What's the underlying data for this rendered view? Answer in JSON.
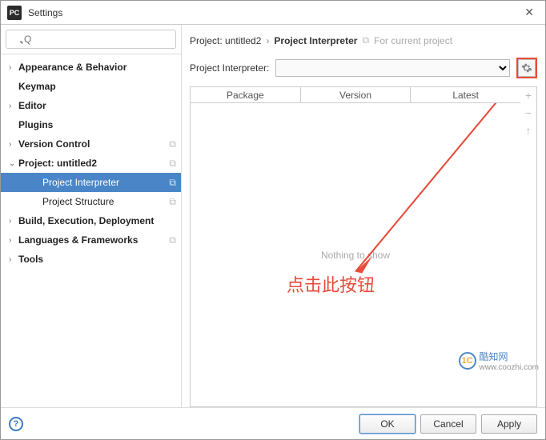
{
  "window": {
    "title": "Settings",
    "app_icon_text": "PC"
  },
  "search": {
    "placeholder": "Q"
  },
  "sidebar": {
    "items": [
      {
        "label": "Appearance & Behavior",
        "expandable": true,
        "bold": true
      },
      {
        "label": "Keymap",
        "expandable": false,
        "bold": true
      },
      {
        "label": "Editor",
        "expandable": true,
        "bold": true
      },
      {
        "label": "Plugins",
        "expandable": false,
        "bold": true
      },
      {
        "label": "Version Control",
        "expandable": true,
        "bold": true,
        "trail": "⧉"
      },
      {
        "label": "Project: untitled2",
        "expandable": true,
        "expanded": true,
        "bold": true,
        "trail": "⧉"
      },
      {
        "label": "Project Interpreter",
        "expandable": false,
        "bold": false,
        "indent": true,
        "selected": true,
        "trail": "⧉"
      },
      {
        "label": "Project Structure",
        "expandable": false,
        "bold": false,
        "indent": true,
        "trail": "⧉"
      },
      {
        "label": "Build, Execution, Deployment",
        "expandable": true,
        "bold": true
      },
      {
        "label": "Languages & Frameworks",
        "expandable": true,
        "bold": true,
        "trail": "⧉"
      },
      {
        "label": "Tools",
        "expandable": true,
        "bold": true
      }
    ]
  },
  "breadcrumbs": {
    "parent": "Project: untitled2",
    "sep": "›",
    "current": "Project Interpreter",
    "note": "For current project"
  },
  "interpreter": {
    "label": "Project Interpreter:",
    "value": ""
  },
  "table": {
    "columns": [
      "Package",
      "Version",
      "Latest"
    ],
    "empty_text": "Nothing to show",
    "side_buttons": [
      "+",
      "−",
      "↑"
    ]
  },
  "annotation": {
    "text": "点击此按钮"
  },
  "footer": {
    "ok": "OK",
    "cancel": "Cancel",
    "apply": "Apply",
    "help": "?"
  },
  "watermark": {
    "icon": "1C",
    "title": "酷知网",
    "sub": "www.coozhi.com"
  }
}
